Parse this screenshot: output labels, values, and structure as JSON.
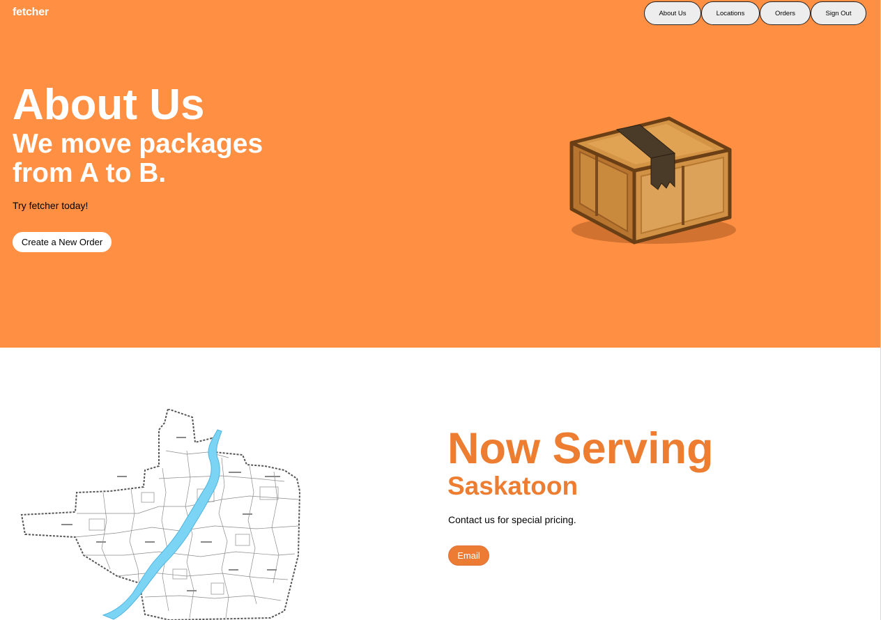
{
  "brand": {
    "name": "fetcher"
  },
  "nav": {
    "items": [
      {
        "label": "About Us"
      },
      {
        "label": "Locations"
      },
      {
        "label": "Orders"
      },
      {
        "label": "Sign Out"
      }
    ]
  },
  "hero": {
    "title": "About Us",
    "subtitle": "We move packages from A to B.",
    "text": "Try fetcher today!",
    "cta_label": "Create a New Order",
    "image_icon": "package-box-icon",
    "background_color": "#FF8F43"
  },
  "serving": {
    "title": "Now Serving",
    "subtitle": "Saskatoon",
    "text": "Contact us for special pricing.",
    "email_label": "Email",
    "image_icon": "city-map-icon",
    "accent_color": "#ED7D31"
  }
}
